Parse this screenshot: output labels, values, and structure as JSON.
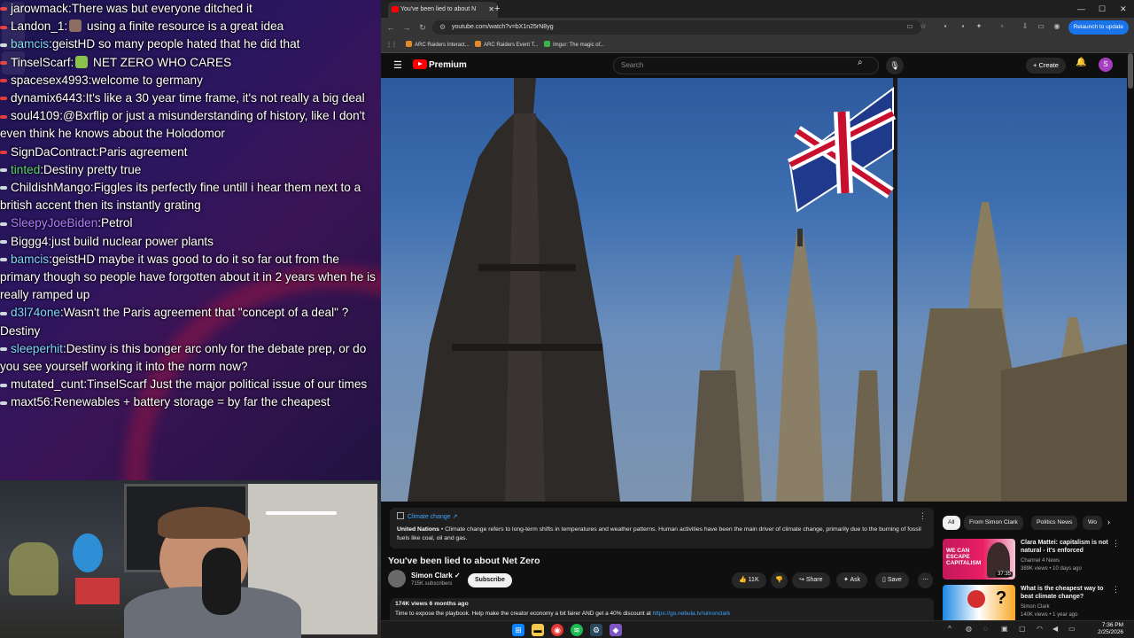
{
  "chat": {
    "messages": [
      {
        "user": "jarowmack",
        "user_color": "#ffffff",
        "dot_color": "#e33b3b",
        "text": "There was but everyone ditched it"
      },
      {
        "user": "Landon_1",
        "user_color": "#ffffff",
        "dot_color": "#e33b3b",
        "text": " using a finite resource is a great idea"
      },
      {
        "user": "bamcis",
        "user_color": "#7fd6ff",
        "dot_color": "#cfd8dc",
        "text": "geistHD so many people hated that he did that"
      },
      {
        "user": "TinselScarf",
        "user_color": "#ffffff",
        "dot_color": "#e33b3b",
        "text": " NET ZERO WHO CARES"
      },
      {
        "user": "spacesex4993",
        "user_color": "#ffffff",
        "dot_color": "#e33b3b",
        "text": "welcome to germany"
      },
      {
        "user": "dynamix6443",
        "user_color": "#ffffff",
        "dot_color": "#e33b3b",
        "text": "It's like a 30 year time frame, it's not really a big deal"
      },
      {
        "user": "soul4109",
        "user_color": "#ffffff",
        "dot_color": "#e33b3b",
        "text": "@Bxrflip or just a misunderstanding of history, like I don't even think he knows about the Holodomor"
      },
      {
        "user": "SignDaContract",
        "user_color": "#ffffff",
        "dot_color": "#e33b3b",
        "text": "Paris agreement"
      },
      {
        "user": "tinted",
        "user_color": "#5bd36f",
        "dot_color": "#cfd8dc",
        "text": "Destiny pretty true"
      },
      {
        "user": "ChildishMango",
        "user_color": "#ffffff",
        "dot_color": "#cfd8dc",
        "text": "Figgles  its perfectly fine untill i hear them next to a british accent then its instantly grating"
      },
      {
        "user": "SleepyJoeBiden",
        "user_color": "#b07cff",
        "dot_color": "#cfd8dc",
        "text": "Petrol"
      },
      {
        "user": "Biggg4",
        "user_color": "#ffffff",
        "dot_color": "#cfd8dc",
        "text": "just build nuclear power plants"
      },
      {
        "user": "bamcis",
        "user_color": "#7fd6ff",
        "dot_color": "#cfd8dc",
        "text": "geistHD maybe it was good to do it so far out from the primary though so people have forgotten about it in 2 years when he is really ramped up"
      },
      {
        "user": "d3l74one",
        "user_color": "#7fd6ff",
        "dot_color": "#cfd8dc",
        "text": "Wasn't the Paris agreement that \"concept of a deal\" ? Destiny"
      },
      {
        "user": "sleeperhit",
        "user_color": "#7fd6ff",
        "dot_color": "#cfd8dc",
        "text": "Destiny is this bonger arc only for the debate prep, or do you see yourself working it into the norm now?"
      },
      {
        "user": "mutated_cunt",
        "user_color": "#ffffff",
        "dot_color": "#cfd8dc",
        "text": "TinselScarf Just the major political issue of our times "
      },
      {
        "user": "maxt56",
        "user_color": "#ffffff",
        "dot_color": "#cfd8dc",
        "text": "Renewables + battery storage = by far the cheapest"
      }
    ],
    "dock": [
      "Epic Games",
      "Launcher",
      "ARC Raiders",
      "Obsidian"
    ]
  },
  "browser": {
    "tab_title": "You've been lied to about N",
    "url": "youtube.com/watch?v=bX1n25rN8yg",
    "relaunch_label": "Relaunch to update",
    "bookmarks": [
      "ARC Raiders Interact...",
      "ARC Raiders Event T...",
      "Imgur: The magic of..."
    ]
  },
  "youtube": {
    "logo_text": "Premium",
    "search_placeholder": "Search",
    "create_label": "Create",
    "avatar_letter": "S",
    "info": {
      "topic": "Climate change",
      "source": "United Nations",
      "text": " • Climate change refers to long-term shifts in temperatures and weather patterns. Human activities have been the main driver of climate change, primarily due to the burning of fossil fuels like coal, oil and gas."
    },
    "video_title": "You've been lied to about Net Zero",
    "channel_name": "Simon Clark",
    "subscribers": "715K subscribers",
    "subscribe_label": "Subscribe",
    "likes": "11K",
    "share_label": "Share",
    "ask_label": "Ask",
    "save_label": "Save",
    "views_meta": "174K views  6 months ago",
    "desc_text": "Time to expose the playbook. Help make the creator economy a bit fairer AND get a 40% discount at ",
    "desc_link": "https://go.nebula.tv/simonclark",
    "chips": [
      "All",
      "From Simon Clark",
      "Politics News",
      "Wo"
    ],
    "recommendations": [
      {
        "title": "Clara Mattei: capitalism is not natural - it's enforced",
        "channel": "Channel 4 News",
        "meta": "389K views • 10 days ago",
        "duration": "37:35",
        "thumb_text": "WE CAN ESCAPE CAPITALISM"
      },
      {
        "title": "What is the cheapest way to beat climate change?",
        "channel": "Simon Clark",
        "meta": "140K views • 1 year ago",
        "duration": "",
        "thumb_text": "?"
      }
    ]
  },
  "taskbar": {
    "time": "7:36 PM",
    "date": "2/25/2026"
  },
  "colors": {
    "youtube_red": "#ff0000",
    "chrome_blue": "#1a73e8",
    "link_blue": "#3ea6ff"
  }
}
